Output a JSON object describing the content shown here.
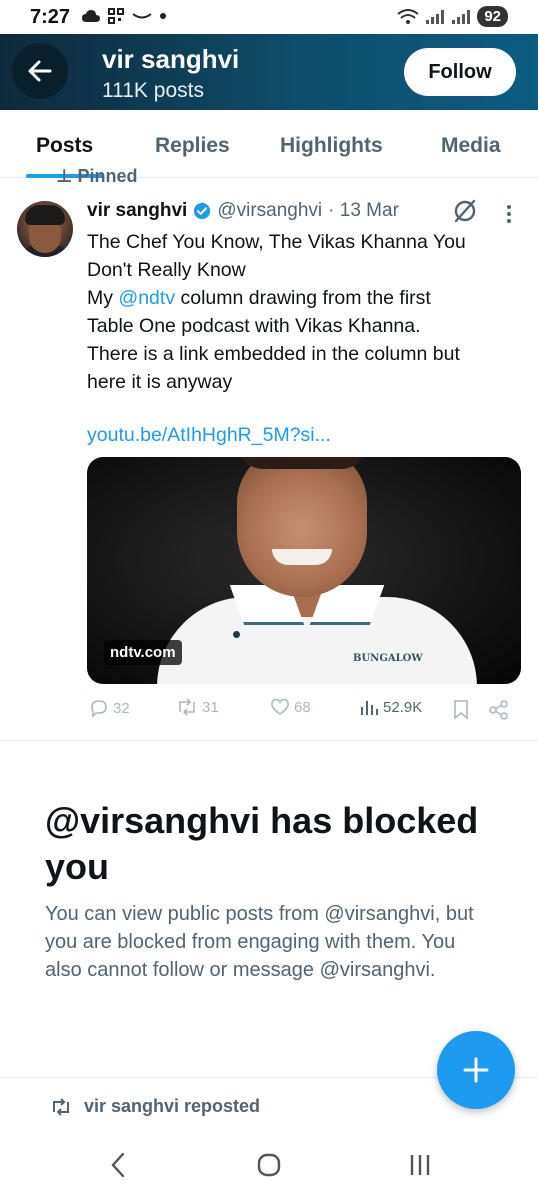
{
  "status_bar": {
    "time": "7:27",
    "battery": "92"
  },
  "header": {
    "name": "vir sanghvi",
    "post_count": "111K posts",
    "follow_label": "Follow"
  },
  "tabs": [
    {
      "label": "Posts",
      "active": true
    },
    {
      "label": "Replies",
      "active": false
    },
    {
      "label": "Highlights",
      "active": false
    },
    {
      "label": "Media",
      "active": false
    }
  ],
  "pinned_label": "Pinned",
  "tweet": {
    "author_name": "vir sanghvi",
    "handle": "@virsanghvi",
    "date": "· 13 Mar",
    "text_lines": {
      "line1": "The Chef You Know, The Vikas Khanna You",
      "line2": "Don't Really Know",
      "line3_pre": "My ",
      "line3_mention": "@ndtv",
      "line3_post": " column drawing from the first",
      "line4": "Table One podcast with Vikas Khanna.",
      "line5": "There is a link embedded in the column but",
      "line6": "here it is anyway"
    },
    "link": "youtu.be/AtIhHghR_5M?si...",
    "media_source": "ndtv.com",
    "media_logo_text": "BUNGALOW",
    "stats": {
      "replies": "32",
      "reposts": "31",
      "likes": "68",
      "views": "52.9K"
    }
  },
  "blocked": {
    "title": "@virsanghvi has blocked you",
    "description": "You can view public posts from @virsanghvi, but you are blocked from engaging with them. You also cannot follow or message @virsanghvi."
  },
  "repost_notice": "vir sanghvi reposted",
  "colors": {
    "accent": "#1d9bf0",
    "header_start": "#0d2a3d",
    "header_end": "#0b5d82",
    "muted": "#536471"
  }
}
